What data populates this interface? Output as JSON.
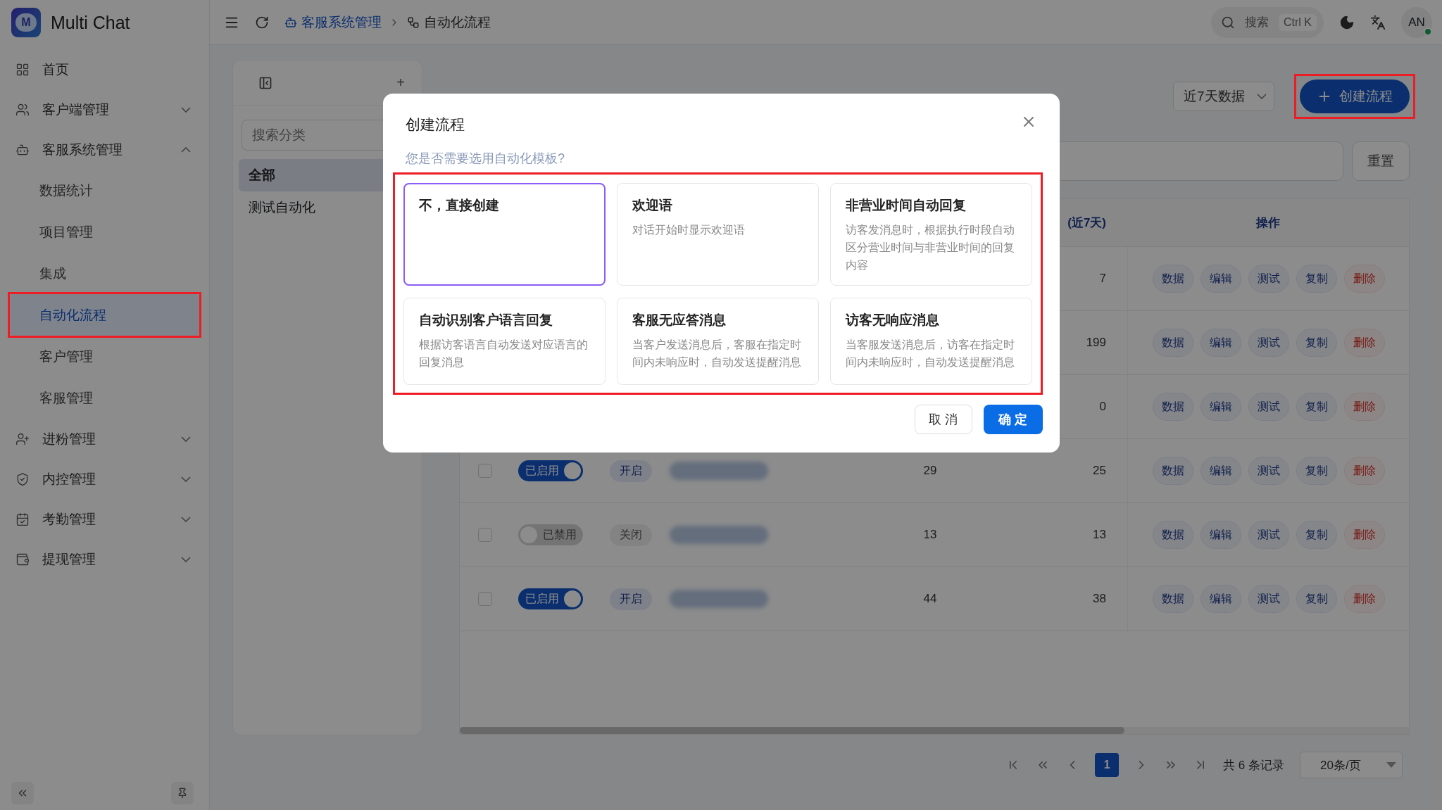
{
  "app": {
    "name": "Multi Chat",
    "logo_letter": "M"
  },
  "sidebar": {
    "items": [
      {
        "label": "首页"
      },
      {
        "label": "客户端管理",
        "expanded": false
      },
      {
        "label": "客服系统管理",
        "expanded": true,
        "children": [
          {
            "label": "数据统计",
            "selected": false
          },
          {
            "label": "项目管理",
            "selected": false
          },
          {
            "label": "集成",
            "selected": false
          },
          {
            "label": "自动化流程",
            "selected": true,
            "highlighted": true
          },
          {
            "label": "客户管理",
            "selected": false
          },
          {
            "label": "客服管理",
            "selected": false
          }
        ]
      },
      {
        "label": "进粉管理",
        "expanded": false
      },
      {
        "label": "内控管理",
        "expanded": false
      },
      {
        "label": "考勤管理",
        "expanded": false
      },
      {
        "label": "提现管理",
        "expanded": false
      }
    ]
  },
  "topbar": {
    "breadcrumb": [
      {
        "label": "客服系统管理"
      },
      {
        "label": "自动化流程"
      }
    ],
    "search": {
      "placeholder": "搜索",
      "shortcut": "Ctrl K"
    },
    "avatar": {
      "initials": "AN",
      "online": true
    }
  },
  "categories": {
    "add": "+",
    "search_placeholder": "搜索分类",
    "items": [
      {
        "label": "全部",
        "selected": true
      },
      {
        "label": "测试自动化",
        "selected": false
      }
    ]
  },
  "toolbar": {
    "range": "近7天数据",
    "create": {
      "label": "创建流程",
      "highlighted": true
    },
    "reset": "重置"
  },
  "table": {
    "header": {
      "column_7": "(近7天)",
      "actions": "操作"
    },
    "rows": [
      {
        "count_2": "7",
        "actions": [
          {
            "label": "数据"
          },
          {
            "label": "编辑"
          },
          {
            "label": "测试"
          },
          {
            "label": "复制"
          },
          {
            "label": "删除",
            "kind": "danger"
          }
        ]
      },
      {
        "count_2": "199",
        "actions": [
          {
            "label": "数据"
          },
          {
            "label": "编辑"
          },
          {
            "label": "测试"
          },
          {
            "label": "复制"
          },
          {
            "label": "删除",
            "kind": "danger"
          }
        ]
      },
      {
        "count_2": "0",
        "actions": [
          {
            "label": "数据"
          },
          {
            "label": "编辑"
          },
          {
            "label": "测试"
          },
          {
            "label": "复制"
          },
          {
            "label": "删除",
            "kind": "danger"
          }
        ]
      },
      {
        "checked": false,
        "enabled": true,
        "switch_label": "已启用",
        "status": "开启",
        "count_1": "29",
        "count_2": "25",
        "actions": [
          {
            "label": "数据"
          },
          {
            "label": "编辑"
          },
          {
            "label": "测试"
          },
          {
            "label": "复制"
          },
          {
            "label": "删除",
            "kind": "danger"
          }
        ]
      },
      {
        "checked": false,
        "enabled": false,
        "switch_label": "已禁用",
        "status": "关闭",
        "count_1": "13",
        "count_2": "13",
        "actions": [
          {
            "label": "数据"
          },
          {
            "label": "编辑"
          },
          {
            "label": "测试"
          },
          {
            "label": "复制"
          },
          {
            "label": "删除",
            "kind": "danger"
          }
        ]
      },
      {
        "checked": false,
        "enabled": true,
        "switch_label": "已启用",
        "status": "开启",
        "count_1": "44",
        "count_2": "38",
        "actions": [
          {
            "label": "数据"
          },
          {
            "label": "编辑"
          },
          {
            "label": "测试"
          },
          {
            "label": "复制"
          },
          {
            "label": "删除",
            "kind": "danger"
          }
        ]
      }
    ]
  },
  "pagination": {
    "pages": [
      {
        "label": "1",
        "selected": true
      }
    ],
    "summary": "共 6 条记录",
    "page_size": "20条/页"
  },
  "dialog": {
    "title": "创建流程",
    "subtitle": "您是否需要选用自动化模板?",
    "templates_highlighted": true,
    "templates": [
      {
        "title": "不，直接创建",
        "selected": true
      },
      {
        "title": "欢迎语",
        "description": "对话开始时显示欢迎语",
        "selected": false
      },
      {
        "title": "非营业时间自动回复",
        "description": "访客发消息时，根据执行时段自动区分营业时间与非营业时间的回复内容",
        "selected": false
      },
      {
        "title": "自动识别客户语言回复",
        "description": "根据访客语言自动发送对应语言的回复消息",
        "selected": false
      },
      {
        "title": "客服无应答消息",
        "description": "当客户发送消息后，客服在指定时间内未响应时，自动发送提醒消息",
        "selected": false
      },
      {
        "title": "访客无响应消息",
        "description": "当客服发送消息后，访客在指定时间内未响应时，自动发送提醒消息",
        "selected": false
      }
    ],
    "cancel": "取 消",
    "confirm": "确 定"
  }
}
